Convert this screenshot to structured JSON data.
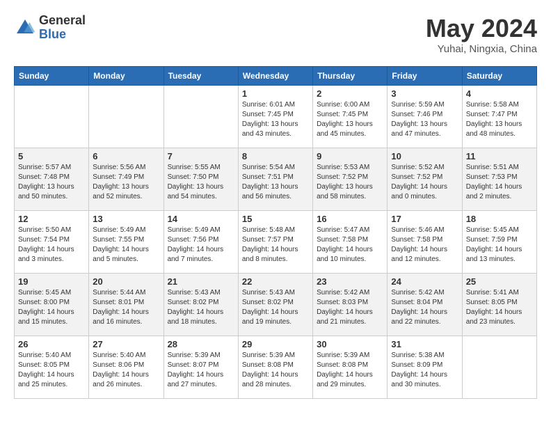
{
  "header": {
    "logo_general": "General",
    "logo_blue": "Blue",
    "title": "May 2024",
    "location": "Yuhai, Ningxia, China"
  },
  "weekdays": [
    "Sunday",
    "Monday",
    "Tuesday",
    "Wednesday",
    "Thursday",
    "Friday",
    "Saturday"
  ],
  "weeks": [
    [
      {
        "day": "",
        "info": ""
      },
      {
        "day": "",
        "info": ""
      },
      {
        "day": "",
        "info": ""
      },
      {
        "day": "1",
        "info": "Sunrise: 6:01 AM\nSunset: 7:45 PM\nDaylight: 13 hours\nand 43 minutes."
      },
      {
        "day": "2",
        "info": "Sunrise: 6:00 AM\nSunset: 7:45 PM\nDaylight: 13 hours\nand 45 minutes."
      },
      {
        "day": "3",
        "info": "Sunrise: 5:59 AM\nSunset: 7:46 PM\nDaylight: 13 hours\nand 47 minutes."
      },
      {
        "day": "4",
        "info": "Sunrise: 5:58 AM\nSunset: 7:47 PM\nDaylight: 13 hours\nand 48 minutes."
      }
    ],
    [
      {
        "day": "5",
        "info": "Sunrise: 5:57 AM\nSunset: 7:48 PM\nDaylight: 13 hours\nand 50 minutes."
      },
      {
        "day": "6",
        "info": "Sunrise: 5:56 AM\nSunset: 7:49 PM\nDaylight: 13 hours\nand 52 minutes."
      },
      {
        "day": "7",
        "info": "Sunrise: 5:55 AM\nSunset: 7:50 PM\nDaylight: 13 hours\nand 54 minutes."
      },
      {
        "day": "8",
        "info": "Sunrise: 5:54 AM\nSunset: 7:51 PM\nDaylight: 13 hours\nand 56 minutes."
      },
      {
        "day": "9",
        "info": "Sunrise: 5:53 AM\nSunset: 7:52 PM\nDaylight: 13 hours\nand 58 minutes."
      },
      {
        "day": "10",
        "info": "Sunrise: 5:52 AM\nSunset: 7:52 PM\nDaylight: 14 hours\nand 0 minutes."
      },
      {
        "day": "11",
        "info": "Sunrise: 5:51 AM\nSunset: 7:53 PM\nDaylight: 14 hours\nand 2 minutes."
      }
    ],
    [
      {
        "day": "12",
        "info": "Sunrise: 5:50 AM\nSunset: 7:54 PM\nDaylight: 14 hours\nand 3 minutes."
      },
      {
        "day": "13",
        "info": "Sunrise: 5:49 AM\nSunset: 7:55 PM\nDaylight: 14 hours\nand 5 minutes."
      },
      {
        "day": "14",
        "info": "Sunrise: 5:49 AM\nSunset: 7:56 PM\nDaylight: 14 hours\nand 7 minutes."
      },
      {
        "day": "15",
        "info": "Sunrise: 5:48 AM\nSunset: 7:57 PM\nDaylight: 14 hours\nand 8 minutes."
      },
      {
        "day": "16",
        "info": "Sunrise: 5:47 AM\nSunset: 7:58 PM\nDaylight: 14 hours\nand 10 minutes."
      },
      {
        "day": "17",
        "info": "Sunrise: 5:46 AM\nSunset: 7:58 PM\nDaylight: 14 hours\nand 12 minutes."
      },
      {
        "day": "18",
        "info": "Sunrise: 5:45 AM\nSunset: 7:59 PM\nDaylight: 14 hours\nand 13 minutes."
      }
    ],
    [
      {
        "day": "19",
        "info": "Sunrise: 5:45 AM\nSunset: 8:00 PM\nDaylight: 14 hours\nand 15 minutes."
      },
      {
        "day": "20",
        "info": "Sunrise: 5:44 AM\nSunset: 8:01 PM\nDaylight: 14 hours\nand 16 minutes."
      },
      {
        "day": "21",
        "info": "Sunrise: 5:43 AM\nSunset: 8:02 PM\nDaylight: 14 hours\nand 18 minutes."
      },
      {
        "day": "22",
        "info": "Sunrise: 5:43 AM\nSunset: 8:02 PM\nDaylight: 14 hours\nand 19 minutes."
      },
      {
        "day": "23",
        "info": "Sunrise: 5:42 AM\nSunset: 8:03 PM\nDaylight: 14 hours\nand 21 minutes."
      },
      {
        "day": "24",
        "info": "Sunrise: 5:42 AM\nSunset: 8:04 PM\nDaylight: 14 hours\nand 22 minutes."
      },
      {
        "day": "25",
        "info": "Sunrise: 5:41 AM\nSunset: 8:05 PM\nDaylight: 14 hours\nand 23 minutes."
      }
    ],
    [
      {
        "day": "26",
        "info": "Sunrise: 5:40 AM\nSunset: 8:05 PM\nDaylight: 14 hours\nand 25 minutes."
      },
      {
        "day": "27",
        "info": "Sunrise: 5:40 AM\nSunset: 8:06 PM\nDaylight: 14 hours\nand 26 minutes."
      },
      {
        "day": "28",
        "info": "Sunrise: 5:39 AM\nSunset: 8:07 PM\nDaylight: 14 hours\nand 27 minutes."
      },
      {
        "day": "29",
        "info": "Sunrise: 5:39 AM\nSunset: 8:08 PM\nDaylight: 14 hours\nand 28 minutes."
      },
      {
        "day": "30",
        "info": "Sunrise: 5:39 AM\nSunset: 8:08 PM\nDaylight: 14 hours\nand 29 minutes."
      },
      {
        "day": "31",
        "info": "Sunrise: 5:38 AM\nSunset: 8:09 PM\nDaylight: 14 hours\nand 30 minutes."
      },
      {
        "day": "",
        "info": ""
      }
    ]
  ]
}
